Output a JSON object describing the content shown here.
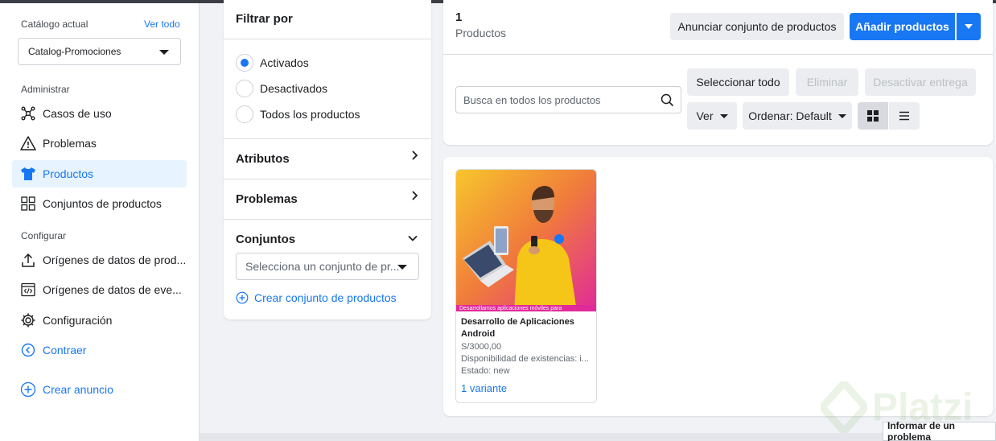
{
  "sidebar": {
    "catalog_label": "Catálogo actual",
    "see_all": "Ver todo",
    "catalog_selected": "Catalog-Promociones",
    "section_manage": "Administrar",
    "items_manage": [
      {
        "label": "Casos de uso",
        "icon": "use-cases-icon"
      },
      {
        "label": "Problemas",
        "icon": "warning-icon"
      },
      {
        "label": "Productos",
        "icon": "tshirt-icon",
        "active": true
      },
      {
        "label": "Conjuntos de productos",
        "icon": "grid-icon"
      }
    ],
    "section_config": "Configurar",
    "items_config": [
      {
        "label": "Orígenes de datos de prod...",
        "icon": "upload-icon"
      },
      {
        "label": "Orígenes de datos de eve...",
        "icon": "code-icon"
      },
      {
        "label": "Configuración",
        "icon": "gear-icon"
      },
      {
        "label": "Contraer",
        "icon": "collapse-icon"
      }
    ],
    "create_ad": "Crear anuncio"
  },
  "filter": {
    "title": "Filtrar por",
    "radios": [
      {
        "label": "Activados",
        "checked": true
      },
      {
        "label": "Desactivados",
        "checked": false
      },
      {
        "label": "Todos los productos",
        "checked": false
      }
    ],
    "sections": [
      "Atributos",
      "Problemas",
      "Conjuntos"
    ],
    "set_placeholder": "Selecciona un conjunto de pr...",
    "create_set": "Crear conjunto de productos"
  },
  "header": {
    "count": "1",
    "count_label": "Productos",
    "announce": "Anunciar conjunto de productos",
    "add": "Añadir productos",
    "search_placeholder": "Busca en todos los productos",
    "select_all": "Seleccionar todo",
    "delete": "Eliminar",
    "deactivate": "Desactivar entrega",
    "view": "Ver",
    "sort": "Ordenar: Default"
  },
  "product": {
    "image_caption": "Desarrollamos aplicaciones móviles para",
    "name": "Desarrollo de Aplicaciones Android",
    "price": "S/3000,00",
    "availability": "Disponibilidad de existencias: i...",
    "state": "Estado: new",
    "variants": "1 variante"
  },
  "watermark": "Platzi",
  "report": "Informar de un problema",
  "colors": {
    "accent": "#1877f2",
    "active_bg": "#e7f3ff"
  }
}
